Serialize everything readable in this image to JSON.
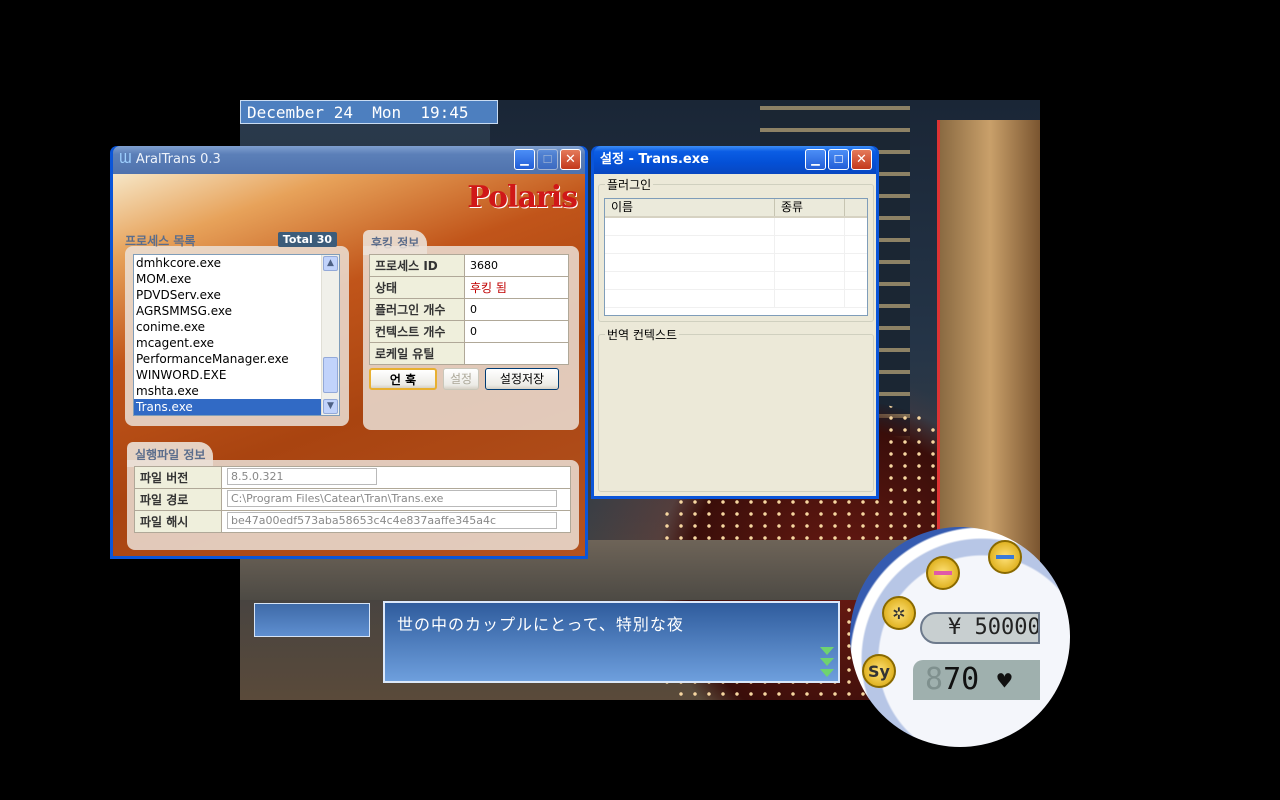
{
  "game": {
    "date_bar": "December 24  Mon  19:45",
    "message_text": "世の中のカップルにとって、特別な夜",
    "speaker_name": "",
    "money": "¥ 50000",
    "hearts_dim": "8",
    "hearts_value": "70",
    "hud_icons": [
      "pink-lamp-icon",
      "blue-lamp-icon",
      "sun-icon",
      "sy-icon"
    ],
    "hud_sy_label": "Sy"
  },
  "aral": {
    "title": "AralTrans 0.3",
    "logo": "Polaris",
    "process_section": {
      "title": "프로세스 목록",
      "total_label": "Total",
      "total_count": "30",
      "items": [
        "dmhkcore.exe",
        "MOM.exe",
        "PDVDServ.exe",
        "AGRSMMSG.exe",
        "conime.exe",
        "mcagent.exe",
        "PerformanceManager.exe",
        "WINWORD.EXE",
        "mshta.exe",
        "Trans.exe"
      ],
      "selected": "Trans.exe"
    },
    "hook_section": {
      "title": "후킹 정보",
      "rows": [
        {
          "label": "프로세스 ID",
          "value": "3680"
        },
        {
          "label": "상태",
          "value": "후킹 됨"
        },
        {
          "label": "플러그인 개수",
          "value": "0"
        },
        {
          "label": "컨텍스트 개수",
          "value": "0"
        },
        {
          "label": "로케일 유틸",
          "value": ""
        }
      ],
      "buttons": {
        "hook": "언 훅",
        "setting": "설정",
        "save": "설정저장"
      }
    },
    "file_section": {
      "title": "실행파일 정보",
      "rows": [
        {
          "label": "파일 버전",
          "value": "8.5.0.321"
        },
        {
          "label": "파일 경로",
          "value": "C:\\Program Files\\Catear\\Tran\\Trans.exe"
        },
        {
          "label": "파일 해시",
          "value": "be47a00edf573aba58653c4c4e837aaffe345a4c"
        }
      ]
    }
  },
  "settings": {
    "title": "설정 - Trans.exe",
    "plugins_group": "플러그인",
    "columns": [
      "이름",
      "종류"
    ],
    "context_group": "번역 컨텍스트"
  },
  "colors": {
    "xp_title_blue": "#0450d6",
    "status_red": "#c00000",
    "selection_blue": "#316ac5"
  }
}
